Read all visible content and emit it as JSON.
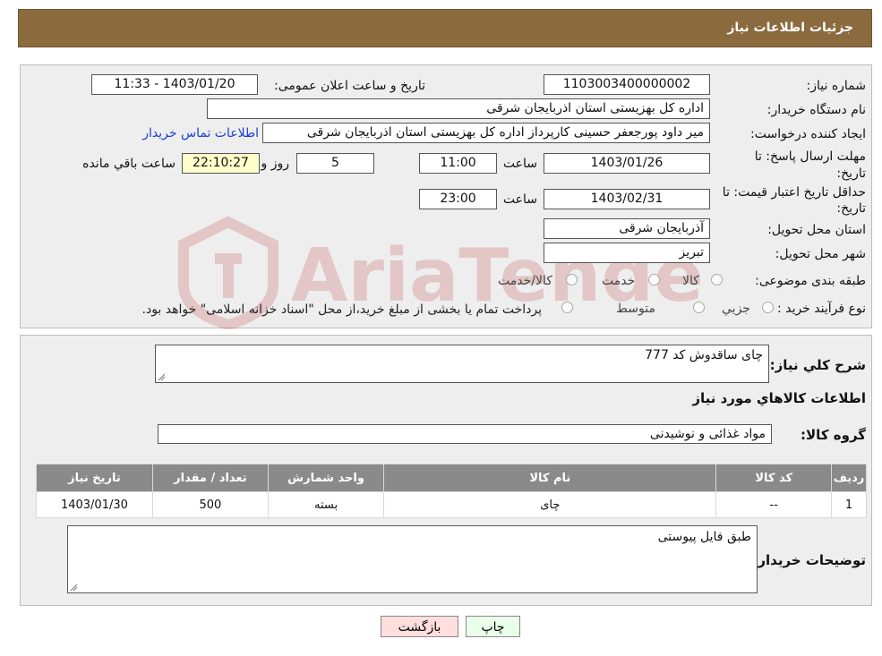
{
  "header": {
    "title": "جزئیات اطلاعات نیاز"
  },
  "form": {
    "need_number_label": "شماره نیاز:",
    "need_number": "1103003400000002",
    "announce_label": "تاریخ و ساعت اعلان عمومی:",
    "announce_value": "1403/01/20 - 11:33",
    "buyer_org_label": "نام دستگاه خریدار:",
    "buyer_org": "اداره کل بهزیستی استان اذربایجان شرقی",
    "creator_label": "ایجاد کننده درخواست:",
    "creator": "میر داود پورجعفر حسینی کارپرداز اداره کل بهزیستی استان اذربایجان شرقی",
    "contact_link": "اطلاعات تماس خریدار",
    "reply_deadline_label_1": "مهلت ارسال پاسخ: تا",
    "reply_deadline_label_2": "تاریخ:",
    "reply_date": "1403/01/26",
    "time_label": "ساعت",
    "reply_time": "11:00",
    "days_value": "5",
    "days_label": "روز و",
    "remaining_time": "22:10:27",
    "remaining_label": "ساعت باقي مانده",
    "validity_label_1": "حداقل تاریخ اعتبار قیمت: تا",
    "validity_label_2": "تاریخ:",
    "validity_date": "1403/02/31",
    "validity_time": "23:00",
    "province_label": "استان محل تحویل:",
    "province": "آذربایجان شرقی",
    "city_label": "شهر محل تحویل:",
    "city": "تبریز",
    "category_label": "طبقه بندی موضوعی:",
    "category_options": [
      "کالا",
      "خدمت",
      "کالا/خدمت"
    ],
    "process_label": "نوع فرآیند خرید :",
    "process_options": [
      "جزیي",
      "متوسط"
    ],
    "process_note": "پرداخت تمام یا بخشی از مبلغ خرید،از محل \"اسناد خزانه اسلامی\" خواهد بود."
  },
  "details": {
    "summary_label": "شرح كلي نياز:",
    "summary": "چای ساقدوش کد 777",
    "goods_info_title": "اطلاعات كالاهاي مورد نياز",
    "group_label": "گروه کالا:",
    "group": "مواد غذائی و نوشیدنی",
    "table": {
      "headers": [
        "ردیف",
        "کد کالا",
        "نام کالا",
        "واحد شمارش",
        "تعداد / مقدار",
        "تاریخ نیاز"
      ],
      "rows": [
        [
          "1",
          "--",
          "چای",
          "بسته",
          "500",
          "1403/01/30"
        ]
      ]
    },
    "buyer_notes_label": "توضیحات خریدار:",
    "buyer_notes": "طبق فایل پیوستی"
  },
  "buttons": {
    "print": "چاپ",
    "back": "بازگشت"
  },
  "watermark_text": "AriaTender.neT",
  "colors": {
    "header_bg": "#8b6a3e",
    "table_header_bg": "#8a8a8a",
    "link": "#1a3dd6",
    "remaining_bg": "#ffffcc",
    "back_bg": "#ffdede",
    "print_bg": "#eaffea"
  }
}
